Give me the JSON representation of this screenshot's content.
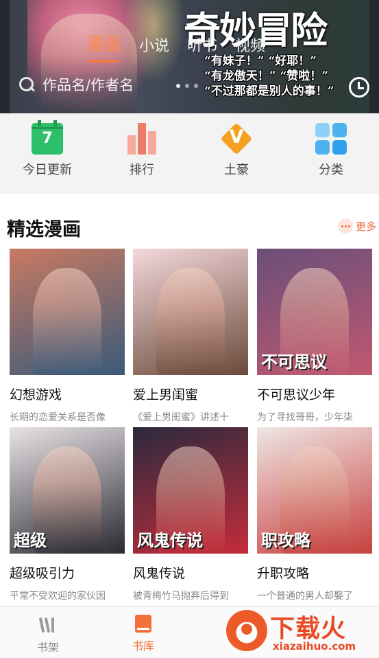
{
  "banner": {
    "tabs": [
      {
        "label": "漫画",
        "active": true
      },
      {
        "label": "小说",
        "active": false
      },
      {
        "label": "听书",
        "active": false
      },
      {
        "label": "视频",
        "active": false
      }
    ],
    "title": "奇妙冒险",
    "quotes": [
      "“有妹子！” “好耶！”",
      "“有龙傲天！” “赞啦！”",
      "“不过那都是别人的事！”"
    ],
    "search_placeholder": "作品名/作者名",
    "carousel_dots": 3,
    "carousel_active": 1
  },
  "quick": [
    {
      "label": "今日更新",
      "icon": "calendar-icon",
      "number": "7"
    },
    {
      "label": "排行",
      "icon": "ranking-bars-icon"
    },
    {
      "label": "土豪",
      "icon": "vip-diamond-icon",
      "letter": "V"
    },
    {
      "label": "分类",
      "icon": "category-grid-icon"
    }
  ],
  "section": {
    "title": "精选漫画",
    "more_label": "更多"
  },
  "comics": [
    {
      "title": "幻想游戏",
      "desc": "长期的恋爱关系是否像",
      "cover_text": "",
      "colors": [
        "#c97a62",
        "#3a5a7a"
      ]
    },
    {
      "title": "爱上男闺蜜",
      "desc": "《爱上男闺蜜》讲述十",
      "cover_text": "",
      "colors": [
        "#f4d9dc",
        "#6b4a3a"
      ]
    },
    {
      "title": "不可思议少年",
      "desc": "为了寻找哥哥，少年柒",
      "cover_text": "不可思议",
      "colors": [
        "#6a4f7a",
        "#c05870"
      ]
    },
    {
      "title": "超级吸引力",
      "desc": "平常不受欢迎的家伙因",
      "cover_text": "超级",
      "colors": [
        "#e9e3e6",
        "#2a2a33"
      ]
    },
    {
      "title": "风鬼传说",
      "desc": "被青梅竹马抛弃后得到",
      "cover_text": "风鬼传说",
      "colors": [
        "#2b2a3e",
        "#c42c3a"
      ]
    },
    {
      "title": "升职攻略",
      "desc": "一个普通的男人却娶了",
      "cover_text": "职攻略",
      "colors": [
        "#efe6e4",
        "#c6403e"
      ]
    }
  ],
  "bottom_nav": [
    {
      "label": "书架",
      "active": false,
      "icon": "bookshelf-icon"
    },
    {
      "label": "书库",
      "active": true,
      "icon": "library-icon"
    }
  ],
  "watermark": {
    "title": "下载火",
    "url": "xiazaihuo.com"
  },
  "colors": {
    "accent": "#f26b2a",
    "quick_bg": "#f3f3f3"
  }
}
